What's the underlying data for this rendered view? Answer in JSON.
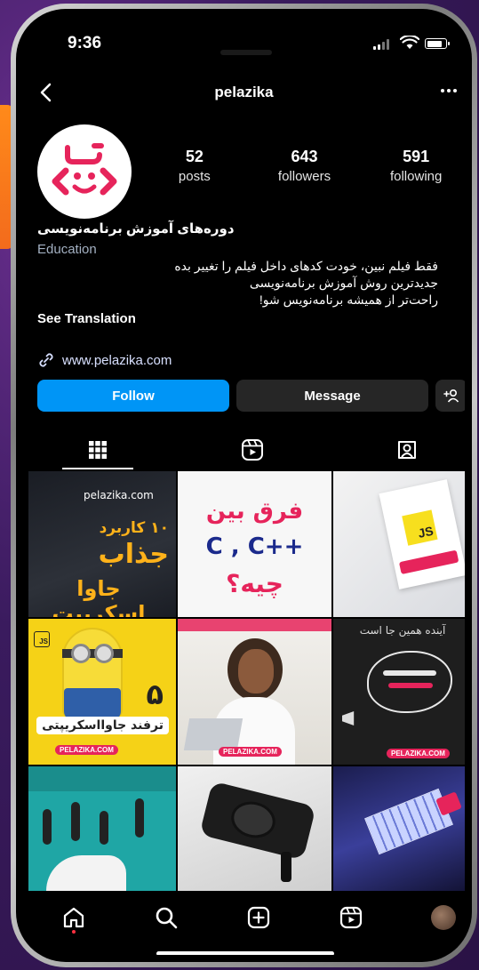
{
  "status_bar": {
    "time": "9:36"
  },
  "header": {
    "username": "pelazika"
  },
  "profile": {
    "stats": [
      {
        "value": "52",
        "label": "posts"
      },
      {
        "value": "643",
        "label": "followers"
      },
      {
        "value": "591",
        "label": "following"
      }
    ],
    "name": "دوره‌های آموزش برنامه‌نویسی",
    "category": "Education",
    "bio_lines": [
      "فقط فیلم نبین، خودت کدهای داخل فیلم را تغییر بده",
      "جدیدترین روش آموزش برنامه‌نویسی",
      "راحت‌تر از همیشه برنامه‌نویس شو!"
    ],
    "see_translation": "See Translation",
    "website": "www.pelazika.com"
  },
  "actions": {
    "follow": "Follow",
    "message": "Message"
  },
  "posts": {
    "p1": {
      "brand": "pelazika.com",
      "line1": "۱۰ کاربرد",
      "line2": "جذاب",
      "line3": "جاوا اسکریپت"
    },
    "p2": {
      "line1": "فرق بین",
      "line2": "C , C++",
      "line3": "چیه؟"
    },
    "p3": {
      "badge": "JS"
    },
    "p4": {
      "badge": "JS",
      "number": "۵",
      "caption": "ترفند جاوااسکریپتی",
      "tag": "PELAZIKA.COM"
    },
    "p5": {
      "tag": "PELAZIKA.COM"
    },
    "p6": {
      "title": "آینده همین جا است",
      "tag": "PELAZIKA.COM"
    }
  },
  "colors": {
    "follow": "#0095f6",
    "button_dark": "#262626",
    "accent": "#e6245b",
    "background": "#000000"
  }
}
